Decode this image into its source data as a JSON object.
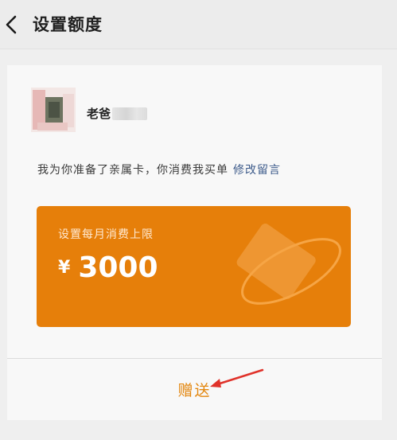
{
  "header": {
    "title": "设置额度",
    "back_icon": "chevron-left-icon"
  },
  "recipient": {
    "name": "老爸"
  },
  "message": {
    "text": "我为你准备了亲属卡，你消费我买单",
    "edit_label": "修改留言"
  },
  "card": {
    "label": "设置每月消费上限",
    "currency": "¥",
    "amount": "3000",
    "color": "#e67f0a",
    "decoration_icon": "card-orbit-icon"
  },
  "action": {
    "gift_label": "赠送",
    "accent": "#e3870f"
  },
  "annotation": {
    "arrow_color": "#e0322a"
  }
}
